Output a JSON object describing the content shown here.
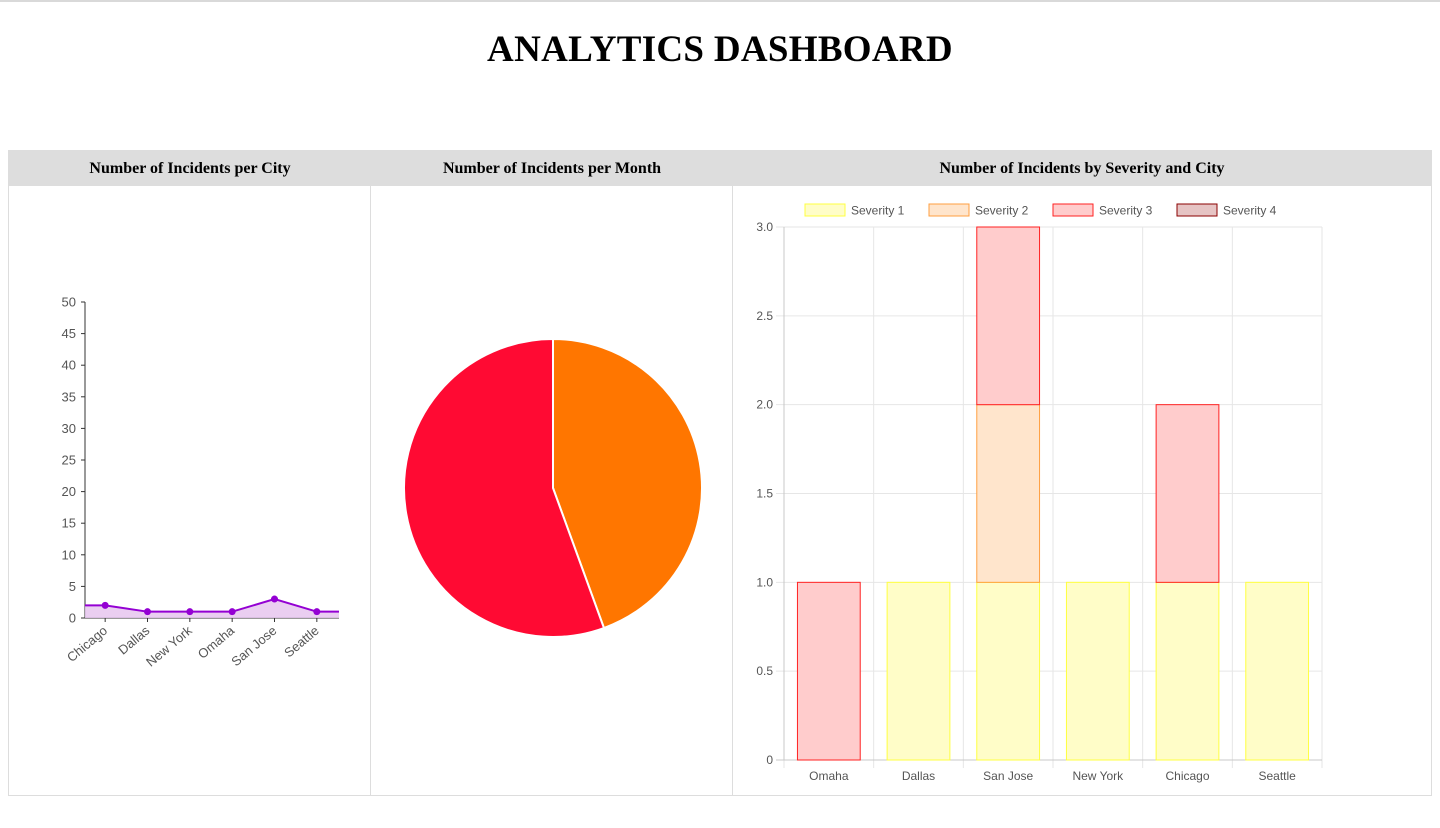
{
  "page": {
    "title": "ANALYTICS DASHBOARD"
  },
  "panels": [
    {
      "header": "Number of Incidents per City"
    },
    {
      "header": "Number of Incidents per Month"
    },
    {
      "header": "Number of Incidents by Severity and City"
    }
  ],
  "colors": {
    "line": "#9400d3",
    "line_fill": "#e6c6ef",
    "pie": [
      "#ff7600",
      "#ff0a33"
    ],
    "sev1_fill": "#fffdc8",
    "sev1_border": "#ffff40",
    "sev2_fill": "#ffe5cc",
    "sev2_border": "#ff9f40",
    "sev3_fill": "#ffcccc",
    "sev3_border": "#f22",
    "sev4_fill": "#e6c4c4",
    "sev4_border": "#8b0000"
  },
  "chart_data": [
    {
      "type": "line",
      "title": "",
      "categories": [
        "Chicago",
        "Dallas",
        "New York",
        "Omaha",
        "San Jose",
        "Seattle"
      ],
      "values": [
        2,
        1,
        1,
        1,
        3,
        1
      ],
      "ylim": [
        0,
        50
      ],
      "yticks": [
        "0",
        "5",
        "10",
        "15",
        "20",
        "25",
        "30",
        "35",
        "40",
        "45",
        "50"
      ],
      "fill": true,
      "grid": false
    },
    {
      "type": "pie",
      "title": "",
      "values": [
        4,
        5
      ],
      "legend": "none"
    },
    {
      "type": "bar",
      "stacked": true,
      "title": "",
      "categories": [
        "Omaha",
        "Dallas",
        "San Jose",
        "New York",
        "Chicago",
        "Seattle"
      ],
      "series": [
        {
          "name": "Severity 1",
          "values": [
            0,
            1,
            1,
            1,
            1,
            1
          ]
        },
        {
          "name": "Severity 2",
          "values": [
            0,
            0,
            1,
            0,
            0,
            0
          ]
        },
        {
          "name": "Severity 3",
          "values": [
            1,
            0,
            1,
            0,
            1,
            0
          ]
        },
        {
          "name": "Severity 4",
          "values": [
            0,
            0,
            0,
            0,
            0,
            0
          ]
        }
      ],
      "ylim": [
        0,
        3
      ],
      "yticks": [
        "0",
        "0.5",
        "1.0",
        "1.5",
        "2.0",
        "2.5",
        "3.0"
      ],
      "grid": true,
      "legend": "top"
    }
  ]
}
